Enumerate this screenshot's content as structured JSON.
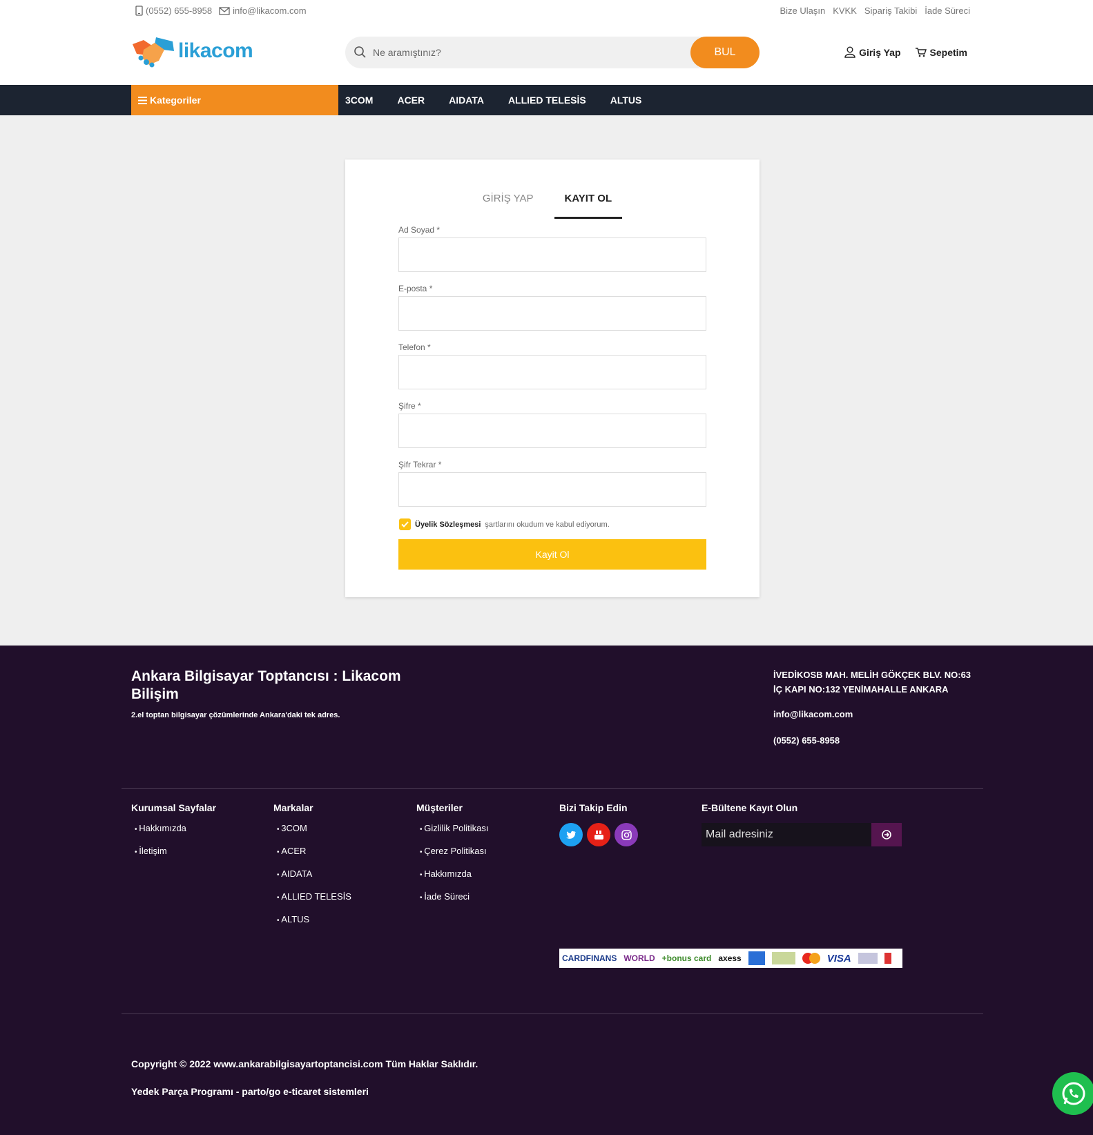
{
  "topbar": {
    "phone": "(0552) 655-8958",
    "email": "info@likacom.com",
    "links": [
      "Bize Ulaşın",
      "KVKK",
      "Sipariş Takibi",
      "İade Süreci"
    ]
  },
  "header": {
    "logo_text": "likacom",
    "search_placeholder": "Ne aramıştınız?",
    "search_button": "BUL",
    "login_label": "Giriş Yap",
    "cart_label": "Sepetim"
  },
  "nav": {
    "categories_label": "Kategoriler",
    "brands": [
      "3COM",
      "ACER",
      "AIDATA",
      "ALLIED TELESİS",
      "ALTUS"
    ]
  },
  "form": {
    "tab_login": "GİRİŞ YAP",
    "tab_register": "KAYIT OL",
    "fields": [
      {
        "label": "Ad Soyad *"
      },
      {
        "label": "E-posta *"
      },
      {
        "label": "Telefon *"
      },
      {
        "label": "Şifre *"
      },
      {
        "label": "Şifr Tekrar *"
      }
    ],
    "agreement_link": "Üyelik Sözleşmesi",
    "agreement_text": "şartlarını okudum ve kabul ediyorum.",
    "submit_label": "Kayit Ol"
  },
  "footer": {
    "title": "Ankara Bilgisayar Toptancısı : Likacom Bilişim",
    "subtitle": "2.el toptan bilgisayar çözümlerinde Ankara'daki tek adres.",
    "address": "İVEDİKOSB MAH. MELİH GÖKÇEK BLV. NO:63 İÇ KAPI NO:132 YENİMAHALLE ANKARA",
    "email": "info@likacom.com",
    "phone": "(0552) 655-8958",
    "col_corporate": {
      "title": "Kurumsal Sayfalar",
      "items": [
        "Hakkımızda",
        "İletişim"
      ]
    },
    "col_brands": {
      "title": "Markalar",
      "items": [
        "3COM",
        "ACER",
        "AIDATA",
        "ALLIED TELESİS",
        "ALTUS"
      ]
    },
    "col_customers": {
      "title": "Müşteriler",
      "items": [
        "Gizlilik Politikası",
        "Çerez Politikası",
        "Hakkımızda",
        "İade Süreci"
      ]
    },
    "follow_title": "Bizi Takip Edin",
    "newsletter_title": "E-Bültene Kayıt Olun",
    "newsletter_placeholder": "Mail adresiniz",
    "payment_logos": [
      "CARDFINANS",
      "WORLD",
      "+bonus card",
      "axess",
      "VISA"
    ],
    "copyright": "Copyright © 2022 www.ankarabilgisayartoptancisi.com Tüm Haklar Saklıdır.",
    "powered": "Yedek Parça Programı - parto/go e-ticaret sistemleri"
  },
  "colors": {
    "accent_orange": "#f28c1e",
    "nav_dark": "#1c2431",
    "button_yellow": "#fbc110",
    "footer_bg": "#210f2b",
    "twitter": "#1da1f2",
    "youtube": "#e62117",
    "instagram": "#8a3ab9",
    "whatsapp": "#1fbf4f"
  }
}
